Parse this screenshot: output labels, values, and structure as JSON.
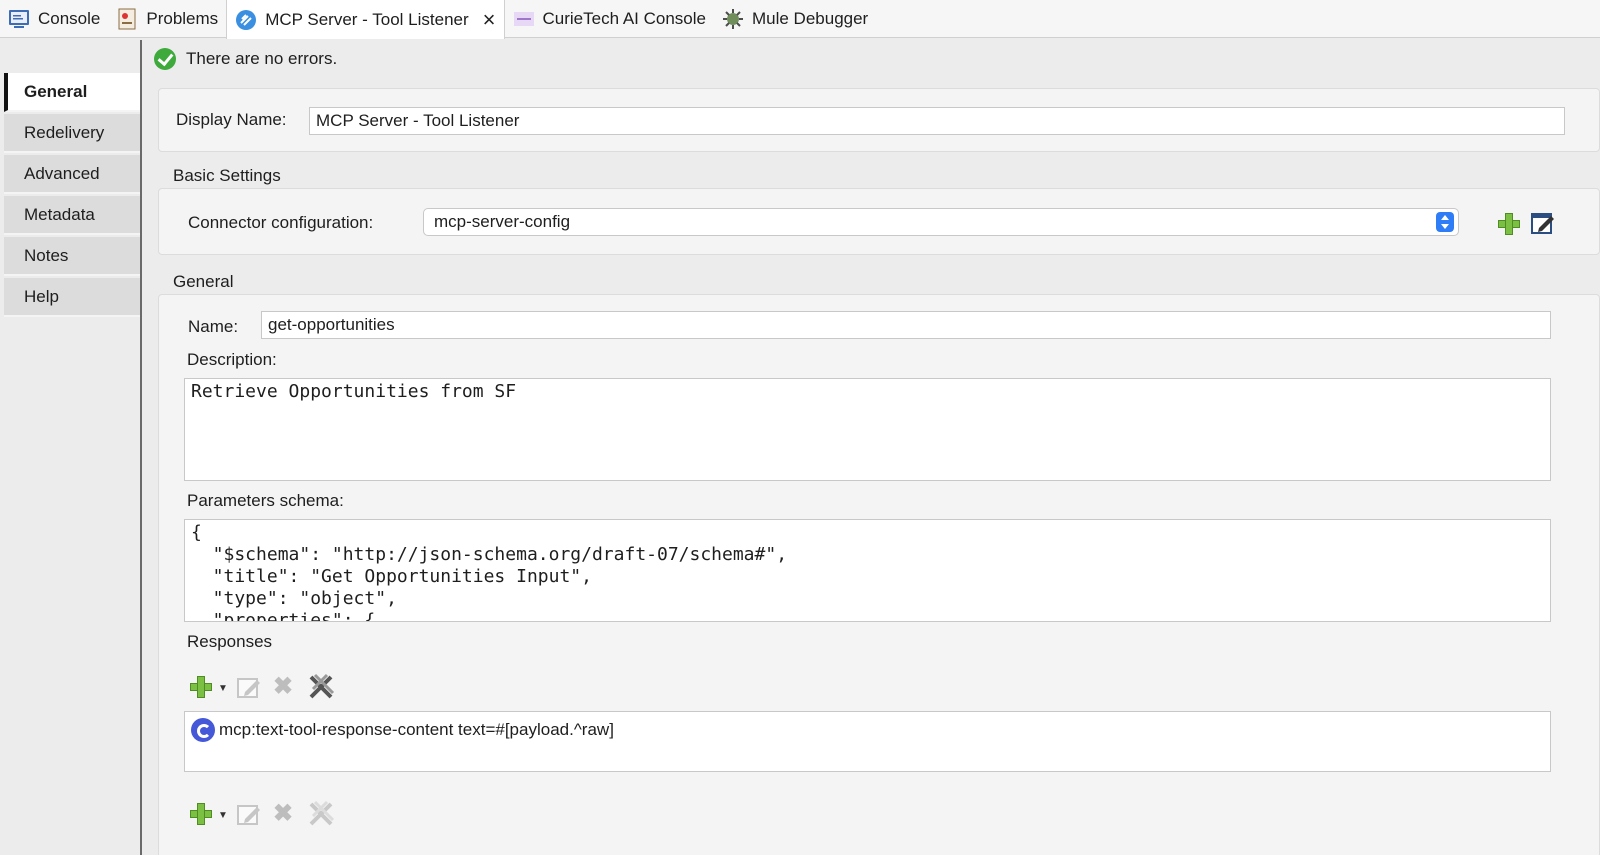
{
  "tabs": [
    {
      "label": "Console",
      "icon": "console-icon"
    },
    {
      "label": "Problems",
      "icon": "problems-icon"
    },
    {
      "label": "MCP Server - Tool Listener",
      "icon": "mcp-icon",
      "active": true
    },
    {
      "label": "CurieTech AI Console",
      "icon": "curietech-icon"
    },
    {
      "label": "Mule Debugger",
      "icon": "debugger-icon"
    }
  ],
  "sidebar": {
    "items": [
      {
        "label": "General"
      },
      {
        "label": "Redelivery"
      },
      {
        "label": "Advanced"
      },
      {
        "label": "Metadata"
      },
      {
        "label": "Notes"
      },
      {
        "label": "Help"
      }
    ]
  },
  "status": {
    "text": "There are no errors."
  },
  "display": {
    "label": "Display Name:",
    "value": "MCP Server - Tool Listener"
  },
  "basic": {
    "title": "Basic Settings",
    "connector_label": "Connector configuration:",
    "connector_value": "mcp-server-config"
  },
  "general": {
    "title": "General",
    "name_label": "Name:",
    "name_value": "get-opportunities",
    "description_label": "Description:",
    "description_value": "Retrieve Opportunities from SF",
    "schema_label": "Parameters schema:",
    "schema_value": "{\n  \"$schema\": \"http://json-schema.org/draft-07/schema#\",\n  \"title\": \"Get Opportunities Input\",\n  \"type\": \"object\",\n  \"properties\": {",
    "responses_label": "Responses",
    "response_item": "mcp:text-tool-response-content text=#[payload.^raw]"
  },
  "colors": {
    "accent": "#2f7df6",
    "success": "#3eaa3c",
    "add_green": "#7cc043"
  }
}
